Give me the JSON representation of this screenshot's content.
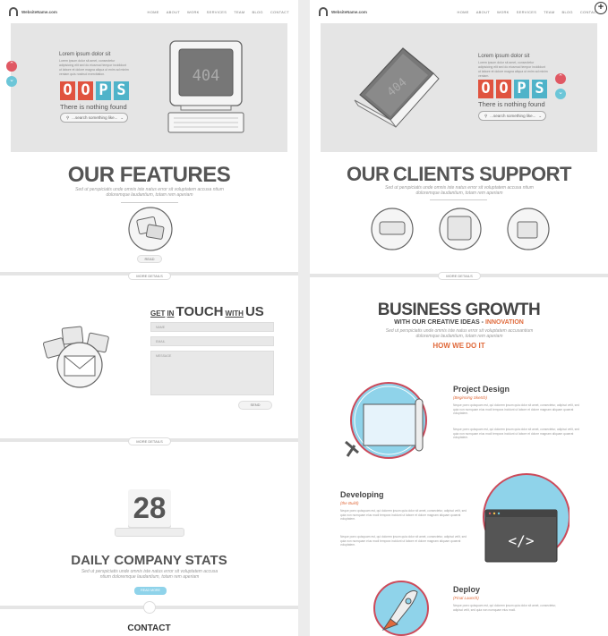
{
  "site": {
    "logo_text": "WebsiteName.com",
    "nav": [
      "HOME",
      "ABOUT",
      "WORK",
      "SERVICES",
      "TEAM",
      "BLOG",
      "CONTACT"
    ]
  },
  "left": {
    "hero": {
      "heading": "Lorem ipsum dolor sit",
      "paragraph": "Lorem ipsum dolor sit amet, consectetur adipisicing elit sed do eiusmod tempor incididunt ut labore et dolore magna aliqua ut enim ad minim veniam quis nostrud exercitation.",
      "oops_letters": [
        "O",
        "O",
        "P",
        "S"
      ],
      "tagline": "There is nothing found",
      "search_placeholder": "...search something like...",
      "screen_text": "404"
    },
    "features": {
      "title": "OUR FEATURES",
      "subtitle": "Sed ut perspiciatis unde omnis iste natus error sit voluptatem accusa ntium doloremque laudantium, totam rem aperiam",
      "read_label": "READ",
      "more_details": "MORE DETAILS"
    },
    "contact_form": {
      "title_get": "GET",
      "title_in": "IN",
      "title_touch": "TOUCH",
      "title_with": "WITH",
      "title_us": "US",
      "name_placeholder": "NAME",
      "email_placeholder": "EMAIL",
      "message_placeholder": "MESSAGE",
      "send_label": "SEND",
      "more_details": "MORE DETAILS"
    },
    "stats": {
      "number": "28",
      "title_daily": "DAILY",
      "title_company": "COMPANY STATS",
      "subtitle": "Sed ut perspiciatis unde omnis iste natus error sit voluptatem accusa ntium doloremque laudantium, totam rem aperiam",
      "button": "READ MORE"
    },
    "contact": {
      "title": "CONTACT"
    }
  },
  "right": {
    "hero": {
      "heading": "Lorem ipsum dolor sit",
      "paragraph": "Lorem ipsum dolor sit amet, consectetur adipisicing elit sed do eiusmod tempor incididunt ut labore et dolore magna aliqua ut enim ad minim veniam.",
      "oops_letters": [
        "O",
        "O",
        "P",
        "S"
      ],
      "tagline": "There is nothing found",
      "search_placeholder": "...search something like...",
      "screen_text": "404"
    },
    "clients": {
      "title_our": "OUR",
      "title_rest": "CLIENTS SUPPORT",
      "subtitle": "Sed ut perspiciatis unde omnis iste natus error sit voluptatem accusa ntium doloremque laudantium, totam rem aperiam",
      "more_details": "MORE DETAILS"
    },
    "growth": {
      "title": "BUSINESS GROWTH",
      "subtitle_prefix": "WITH OUR CREATIVE IDEAS -",
      "subtitle_highlight": "INNOVATION",
      "desc": "Sed ut perspiciatis unde omnis iste natus error sit voluptatem accusantium doloremque laudantium, totam rem aperiam",
      "how": "HOW WE DO IT",
      "steps": [
        {
          "title": "Project Design",
          "sub": "(Beginning Sketch)",
          "text": "Neque porro quisquam est, qui dolorem ipsum quia dolor sit amet, consectetur, adipisci velit, sed quia non numquam eius modi tempora incidunt ut labore et dolore magnam aliquam quaerat voluptatem."
        },
        {
          "title": "Developing",
          "sub": "(the Build)",
          "text": "Neque porro quisquam est, qui dolorem ipsum quia dolor sit amet, consectetur, adipisci velit, sed quia non numquam eius modi tempora incidunt ut labore et dolore magnam aliquam quaerat voluptatem."
        },
        {
          "title": "Deploy",
          "sub": "(Final Launch)",
          "text": "Neque porro quisquam est, qui dolorem ipsum quia dolor sit amet, consectetur, adipisci velit, sed quia non numquam eius modi."
        }
      ]
    }
  },
  "colors": {
    "oops": [
      "#e0533f",
      "#e0533f",
      "#4fb3c9",
      "#4fb3c9"
    ],
    "accent_orange": "#e06a3b",
    "accent_blue": "#8fd3ea",
    "accent_red": "#cc4a5a",
    "toggle_red": "#e05863",
    "toggle_blue": "#6cc6d8"
  }
}
